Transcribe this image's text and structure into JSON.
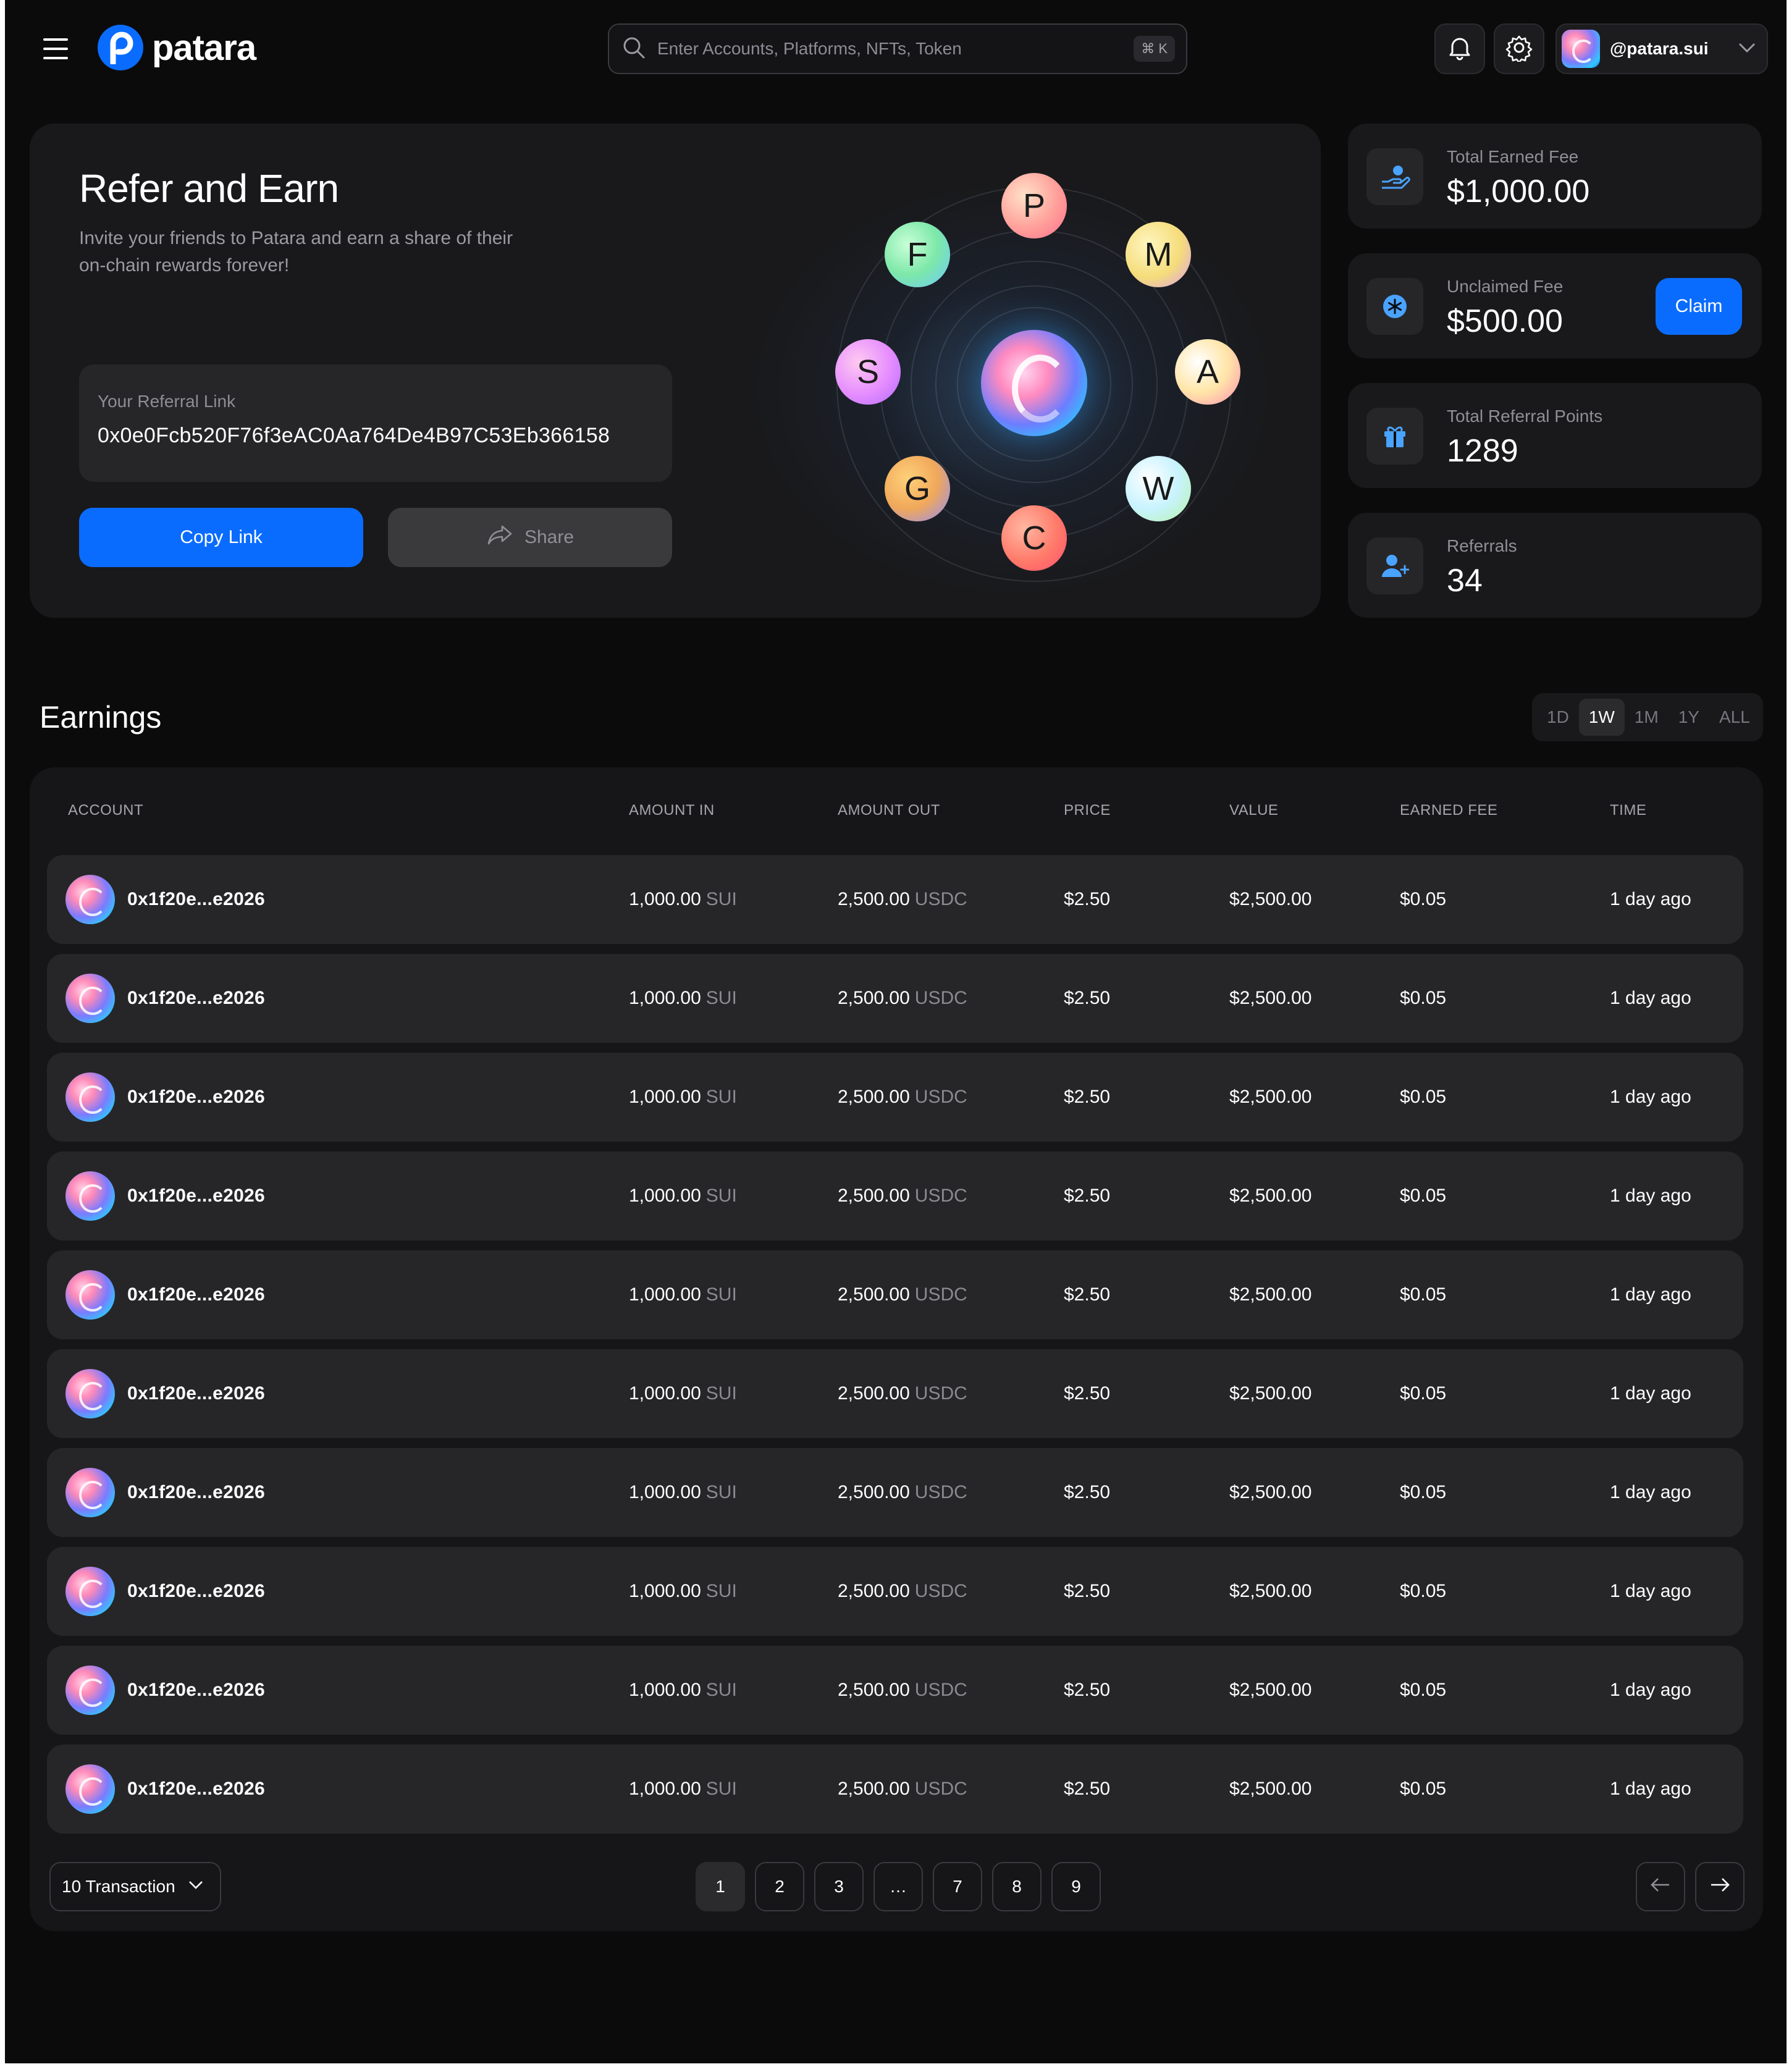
{
  "header": {
    "brand": "patara",
    "search_placeholder": "Enter Accounts, Platforms, NFTs, Token",
    "search_shortcut": "⌘ K",
    "username": "@patara.sui"
  },
  "refer": {
    "title": "Refer and Earn",
    "subtitle": "Invite your friends to Patara and earn a share of their on-chain rewards forever!",
    "link_label": "Your Referral Link",
    "link_value": "0x0e0Fcb520F76f3eAC0Aa764De4B97C53Eb366158",
    "copy_label": "Copy Link",
    "share_label": "Share",
    "orbit_letters": [
      "P",
      "M",
      "A",
      "W",
      "C",
      "G",
      "S",
      "F"
    ]
  },
  "stats": [
    {
      "label": "Total Earned Fee",
      "value": "$1,000.00",
      "icon": "hand-coin-icon"
    },
    {
      "label": "Unclaimed Fee",
      "value": "$500.00",
      "icon": "snowflake-icon",
      "action": "Claim"
    },
    {
      "label": "Total Referral Points",
      "value": "1289",
      "icon": "gift-icon"
    },
    {
      "label": "Referrals",
      "value": "34",
      "icon": "add-user-icon"
    }
  ],
  "earnings": {
    "title": "Earnings",
    "timeframes": [
      "1D",
      "1W",
      "1M",
      "1Y",
      "ALL"
    ],
    "active_timeframe": "1W",
    "columns": [
      "ACCOUNT",
      "AMOUNT IN",
      "AMOUNT OUT",
      "PRICE",
      "VALUE",
      "EARNED FEE",
      "TIME"
    ],
    "rows": [
      {
        "account": "0x1f20e...e2026",
        "amount_in": "1,000.00",
        "in_unit": "SUI",
        "amount_out": "2,500.00",
        "out_unit": "USDC",
        "price": "$2.50",
        "value": "$2,500.00",
        "fee": "$0.05",
        "time": "1 day ago"
      },
      {
        "account": "0x1f20e...e2026",
        "amount_in": "1,000.00",
        "in_unit": "SUI",
        "amount_out": "2,500.00",
        "out_unit": "USDC",
        "price": "$2.50",
        "value": "$2,500.00",
        "fee": "$0.05",
        "time": "1 day ago"
      },
      {
        "account": "0x1f20e...e2026",
        "amount_in": "1,000.00",
        "in_unit": "SUI",
        "amount_out": "2,500.00",
        "out_unit": "USDC",
        "price": "$2.50",
        "value": "$2,500.00",
        "fee": "$0.05",
        "time": "1 day ago"
      },
      {
        "account": "0x1f20e...e2026",
        "amount_in": "1,000.00",
        "in_unit": "SUI",
        "amount_out": "2,500.00",
        "out_unit": "USDC",
        "price": "$2.50",
        "value": "$2,500.00",
        "fee": "$0.05",
        "time": "1 day ago"
      },
      {
        "account": "0x1f20e...e2026",
        "amount_in": "1,000.00",
        "in_unit": "SUI",
        "amount_out": "2,500.00",
        "out_unit": "USDC",
        "price": "$2.50",
        "value": "$2,500.00",
        "fee": "$0.05",
        "time": "1 day ago"
      },
      {
        "account": "0x1f20e...e2026",
        "amount_in": "1,000.00",
        "in_unit": "SUI",
        "amount_out": "2,500.00",
        "out_unit": "USDC",
        "price": "$2.50",
        "value": "$2,500.00",
        "fee": "$0.05",
        "time": "1 day ago"
      },
      {
        "account": "0x1f20e...e2026",
        "amount_in": "1,000.00",
        "in_unit": "SUI",
        "amount_out": "2,500.00",
        "out_unit": "USDC",
        "price": "$2.50",
        "value": "$2,500.00",
        "fee": "$0.05",
        "time": "1 day ago"
      },
      {
        "account": "0x1f20e...e2026",
        "amount_in": "1,000.00",
        "in_unit": "SUI",
        "amount_out": "2,500.00",
        "out_unit": "USDC",
        "price": "$2.50",
        "value": "$2,500.00",
        "fee": "$0.05",
        "time": "1 day ago"
      },
      {
        "account": "0x1f20e...e2026",
        "amount_in": "1,000.00",
        "in_unit": "SUI",
        "amount_out": "2,500.00",
        "out_unit": "USDC",
        "price": "$2.50",
        "value": "$2,500.00",
        "fee": "$0.05",
        "time": "1 day ago"
      },
      {
        "account": "0x1f20e...e2026",
        "amount_in": "1,000.00",
        "in_unit": "SUI",
        "amount_out": "2,500.00",
        "out_unit": "USDC",
        "price": "$2.50",
        "value": "$2,500.00",
        "fee": "$0.05",
        "time": "1 day ago"
      }
    ]
  },
  "pagination": {
    "page_size_label": "10 Transaction",
    "pages": [
      "1",
      "2",
      "3",
      "…",
      "7",
      "8",
      "9"
    ],
    "active_page": "1"
  },
  "colors": {
    "accent": "#0a6cff",
    "background": "#0b0b0c",
    "card": "#19191b",
    "row": "#262628"
  }
}
